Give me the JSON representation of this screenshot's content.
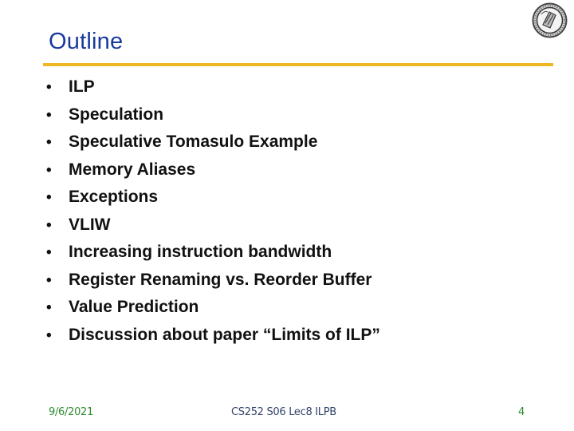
{
  "slide": {
    "title": "Outline",
    "logo_icon": "university-seal-icon",
    "bullet_glyph": "•",
    "bullets": [
      "ILP",
      "Speculation",
      "Speculative Tomasulo Example",
      "Memory Aliases",
      "Exceptions",
      "VLIW",
      "Increasing instruction bandwidth",
      "Register Renaming vs. Reorder Buffer",
      "Value Prediction",
      "Discussion about paper “Limits of ILP”"
    ],
    "colors": {
      "title": "#1a3a9c",
      "rule": "#f0b722",
      "footer_green": "#2e8b2e",
      "footer_blue": "#33446a"
    }
  },
  "footer": {
    "date": "9/6/2021",
    "course": "CS252 S06 Lec8 ILPB",
    "page_number": "4"
  }
}
